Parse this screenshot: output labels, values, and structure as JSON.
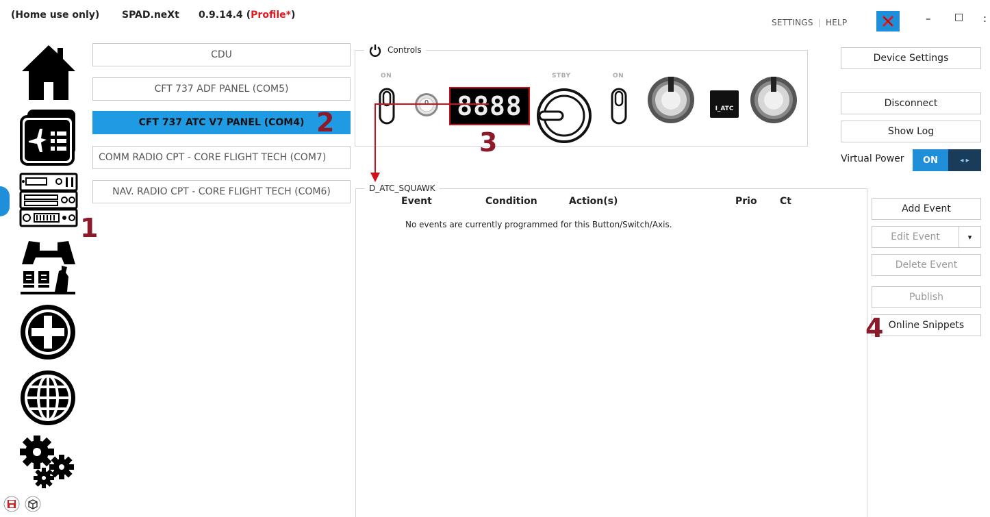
{
  "title": {
    "usage": "(Home use only)",
    "app": "SPAD.neXt",
    "version": "0.9.14.4",
    "profile_open": "(",
    "profile": "Profile*",
    "profile_close": ")"
  },
  "topnav": {
    "settings": "SETTINGS",
    "sep": "|",
    "help": "HELP"
  },
  "window": {
    "minimize": "–",
    "maximize": "□",
    "more": ":"
  },
  "devices": [
    {
      "label": "CDU"
    },
    {
      "label": "CFT 737 ADF PANEL (COM5)"
    },
    {
      "label": "CFT 737 ATC V7 PANEL (COM4)"
    },
    {
      "label": "COMM RADIO CPT - CORE FLIGHT TECH (COM7)"
    },
    {
      "label": "NAV. RADIO CPT - CORE FLIGHT TECH (COM6)"
    }
  ],
  "controls": {
    "title": "Controls",
    "labels": {
      "on1": "ON",
      "stby": "STBY",
      "on2": "ON"
    },
    "knob_small": "0",
    "display_value": "8888",
    "atc_label": "I_ATC"
  },
  "events": {
    "title": "D_ATC_SQUAWK",
    "columns": {
      "event": "Event",
      "condition": "Condition",
      "actions": "Action(s)",
      "prio": "Prio",
      "ct": "Ct"
    },
    "empty_message": "No events are currently programmed for this Button/Switch/Axis."
  },
  "right": {
    "device_settings": "Device Settings",
    "disconnect": "Disconnect",
    "show_log": "Show Log",
    "virtual_power": "Virtual Power",
    "vp_on": "ON",
    "vp_arrows": "◂ ▸",
    "add_event": "Add Event",
    "edit_event": "Edit Event",
    "edit_caret": "▾",
    "delete_event": "Delete Event",
    "publish": "Publish",
    "online_snippets": "Online Snippets"
  },
  "callouts": {
    "c1": "1",
    "c2": "2",
    "c3": "3",
    "c4": "4"
  },
  "colors": {
    "accent": "#1e9be2",
    "callout": "#8b1a2b",
    "profile_red": "#e0191e",
    "arrow_red": "#d0101a"
  },
  "icons": [
    "home-icon",
    "flight-plan-icon",
    "devices-icon",
    "cockpit-icon",
    "add-icon",
    "globe-icon",
    "gears-icon",
    "save-icon",
    "package-icon",
    "power-icon",
    "close-icon"
  ]
}
